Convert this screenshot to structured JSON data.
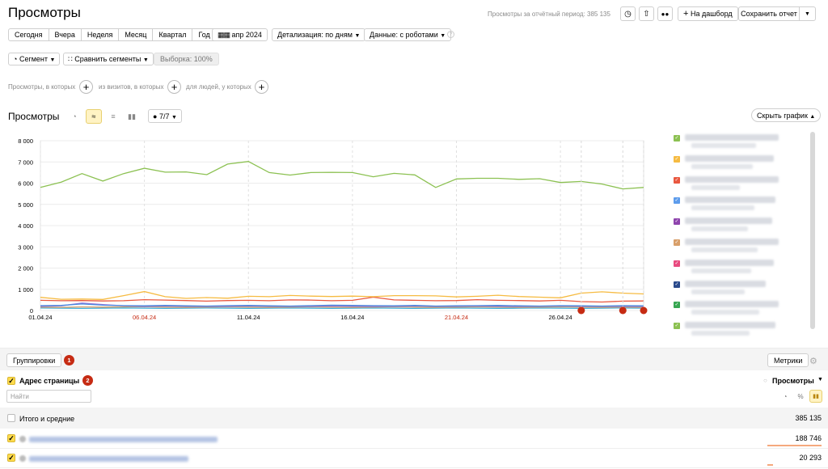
{
  "header": {
    "title": "Просмотры",
    "period_text": "Просмотры за отчётный период: 385 135",
    "dashboard_label": "На дашборд",
    "save_label": "Сохранить отчет"
  },
  "periods": [
    "Сегодня",
    "Вчера",
    "Неделя",
    "Месяц",
    "Квартал",
    "Год"
  ],
  "date_label": "апр 2024",
  "detail_label": "Детализация: по дням",
  "data_label": "Данные: с роботами",
  "segment_label": "Сегмент",
  "compare_label": "Сравнить сегменты",
  "sample_label": "Выборка: 100%",
  "conditions": [
    "Просмотры, в которых",
    "из визитов, в которых",
    "для людей, у которых"
  ],
  "chart_header": {
    "title": "Просмотры",
    "series_count": "7/7",
    "hide_label": "Скрыть график"
  },
  "chart_data": {
    "type": "line",
    "x": [
      "01.04.24",
      "02.04.24",
      "03.04.24",
      "04.04.24",
      "05.04.24",
      "06.04.24",
      "07.04.24",
      "08.04.24",
      "09.04.24",
      "10.04.24",
      "11.04.24",
      "12.04.24",
      "13.04.24",
      "14.04.24",
      "15.04.24",
      "16.04.24",
      "17.04.24",
      "18.04.24",
      "19.04.24",
      "20.04.24",
      "21.04.24",
      "22.04.24",
      "23.04.24",
      "24.04.24",
      "25.04.24",
      "26.04.24",
      "27.04.24",
      "28.04.24",
      "29.04.24",
      "30.04.24"
    ],
    "x_tick_labels": [
      "01.04.24",
      "06.04.24",
      "11.04.24",
      "16.04.24",
      "21.04.24",
      "26.04.24"
    ],
    "x_tick_colors": [
      "#000000",
      "#c62b13",
      "#000000",
      "#000000",
      "#c62b13",
      "#000000"
    ],
    "y_ticks": [
      "0",
      "1 000",
      "2 000",
      "3 000",
      "4 000",
      "5 000",
      "6 000",
      "7 000",
      "8 000"
    ],
    "ylim": [
      0,
      8000
    ],
    "grid": true,
    "series": [
      {
        "color": "#8cc152",
        "values": [
          5800,
          6050,
          6450,
          6100,
          6450,
          6700,
          6520,
          6530,
          6400,
          6900,
          7020,
          6500,
          6380,
          6500,
          6510,
          6500,
          6300,
          6460,
          6390,
          5800,
          6200,
          6230,
          6230,
          6180,
          6210,
          6030,
          6080,
          5960,
          5730,
          5800
        ]
      },
      {
        "color": "#f6bb42",
        "values": [
          620,
          530,
          540,
          520,
          700,
          890,
          650,
          570,
          610,
          580,
          670,
          650,
          710,
          680,
          660,
          680,
          650,
          700,
          700,
          690,
          640,
          670,
          720,
          660,
          630,
          600,
          820,
          880,
          820,
          780
        ]
      },
      {
        "color": "#e9573f",
        "values": [
          480,
          460,
          470,
          450,
          460,
          510,
          490,
          470,
          440,
          470,
          480,
          460,
          500,
          490,
          460,
          480,
          630,
          500,
          480,
          460,
          470,
          510,
          480,
          470,
          450,
          480,
          420,
          400,
          440,
          450
        ]
      },
      {
        "color": "#4a89dc",
        "values": [
          230,
          240,
          310,
          250,
          230,
          220,
          240,
          220,
          210,
          230,
          240,
          220,
          210,
          230,
          250,
          240,
          230,
          220,
          240,
          210,
          220,
          230,
          240,
          220,
          210,
          230,
          220,
          210,
          230,
          220
        ]
      },
      {
        "color": "#967adc",
        "values": [
          200,
          220,
          350,
          280,
          220,
          190,
          210,
          200,
          190,
          200,
          210,
          200,
          190,
          200,
          210,
          200,
          190,
          200,
          210,
          190,
          200,
          210,
          200,
          190,
          200,
          210,
          200,
          190,
          200,
          190
        ]
      },
      {
        "color": "#d89f6a",
        "values": [
          160,
          150,
          170,
          160,
          170,
          180,
          160,
          150,
          160,
          170,
          160,
          150,
          160,
          170,
          160,
          150,
          160,
          170,
          160,
          150,
          160,
          170,
          160,
          150,
          160,
          170,
          160,
          150,
          160,
          150
        ]
      },
      {
        "color": "#3bafda",
        "values": [
          120,
          110,
          100,
          110,
          120,
          110,
          100,
          110,
          120,
          110,
          100,
          110,
          120,
          110,
          100,
          110,
          120,
          110,
          100,
          110,
          120,
          110,
          100,
          110,
          120,
          110,
          100,
          110,
          120,
          110
        ]
      }
    ],
    "annotations": [
      {
        "x": "27.04.24"
      },
      {
        "x": "29.04.24"
      },
      {
        "x": "30.04.24"
      }
    ]
  },
  "legend_colors": [
    "#8cc152",
    "#f6bb42",
    "#e9573f",
    "#5d9cec",
    "#8e44ad",
    "#d89f6a",
    "#e84a7f",
    "#2a4a8c",
    "#37a651",
    "#8cc152"
  ],
  "table": {
    "groups_label": "Группировки",
    "groups_badge": "1",
    "dimension": "Адрес страницы",
    "dimension_badge": "2",
    "search_placeholder": "Найти",
    "metrics_label": "Метрики",
    "metric": "Просмотры",
    "percent_label": "%",
    "total_label": "Итого и средние",
    "total_value": "385 135",
    "rows": [
      {
        "value": "188 746",
        "share": 0.49
      },
      {
        "value": "20 293",
        "share": 0.053
      }
    ]
  }
}
